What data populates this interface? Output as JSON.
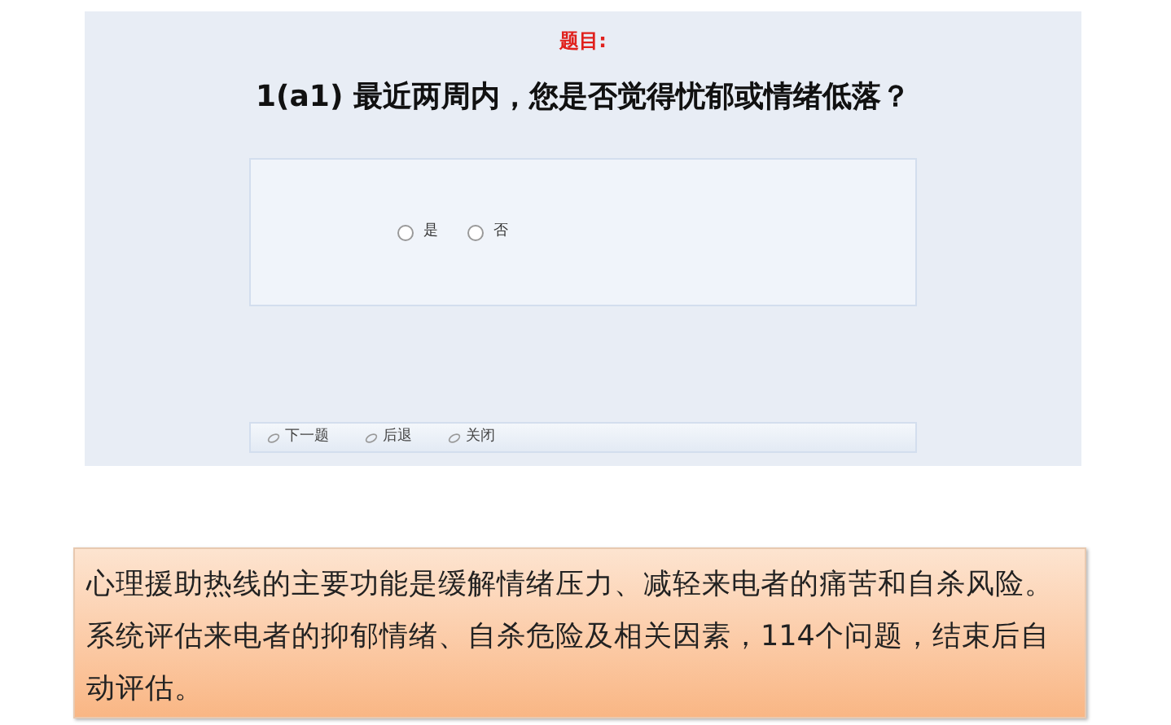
{
  "screenshot": {
    "heading": "题目:",
    "question": "1(a1) 最近两周内，您是否觉得忧郁或情绪低落？",
    "options": [
      {
        "label": "是",
        "selected": false
      },
      {
        "label": "否",
        "selected": false
      }
    ],
    "buttons": [
      "下一题",
      "后退",
      "关闭"
    ]
  },
  "note": "心理援助热线的主要功能是缓解情绪压力、减轻来电者的痛苦和自杀风险。系统评估来电者的抑郁情绪、自杀危险及相关因素，114个问题，结束后自动评估。"
}
